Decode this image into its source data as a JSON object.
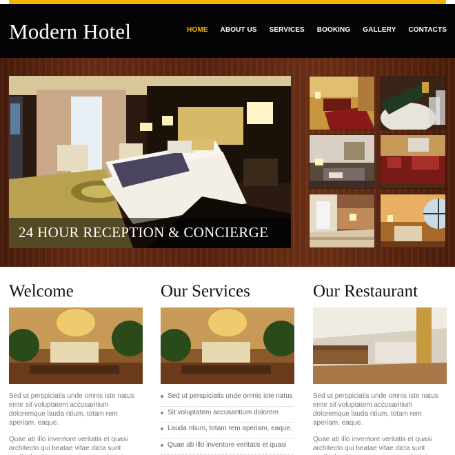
{
  "brand": {
    "name": "Modern Hotel",
    "accent": "#f2b705"
  },
  "nav": [
    {
      "label": "HOME",
      "active": true
    },
    {
      "label": "ABOUT US",
      "active": false
    },
    {
      "label": "SERVICES",
      "active": false
    },
    {
      "label": "BOOKING",
      "active": false
    },
    {
      "label": "GALLERY",
      "active": false
    },
    {
      "label": "CONTACTS",
      "active": false
    }
  ],
  "hero": {
    "caption": "24 HOUR RECEPTION & CONCIERGE"
  },
  "columns": {
    "welcome": {
      "title": "Welcome",
      "p1": "Sed ut perspiciatis unde omnis iste natus error sit voluptatem accusantium doloremque lauda ntium, totam rem aperiam, eaque.",
      "p2": "Quae ab illo inventore veritatis et quasi architecto qui beatae vitae dicta sunt explicabo. Nemo enim ipsam voluptatem quia voluptas sit aspernatur."
    },
    "services": {
      "title": "Our Services",
      "items": [
        "Sed ut perspiciatis unde omnis iste natus",
        "Sit voluptatem accusantium dolorem",
        "Lauda ntium, totam rem aperiam, eaque.",
        "Quae ab illo inventore veritatis et quasi"
      ]
    },
    "restaurant": {
      "title": "Our Restaurant",
      "p1": "Sed ut perspiciatis unde omnis iste natus error sit voluptatem accusantium doloremque lauda ntium, totam rem aperiam, eaque.",
      "p2": "Quae ab illo inventore veritatis et quasi architecto qui beatae vitae dicta sunt explicabo. Nemo enim ipsam voluptatem quia voluptas sit aspernatur."
    }
  }
}
